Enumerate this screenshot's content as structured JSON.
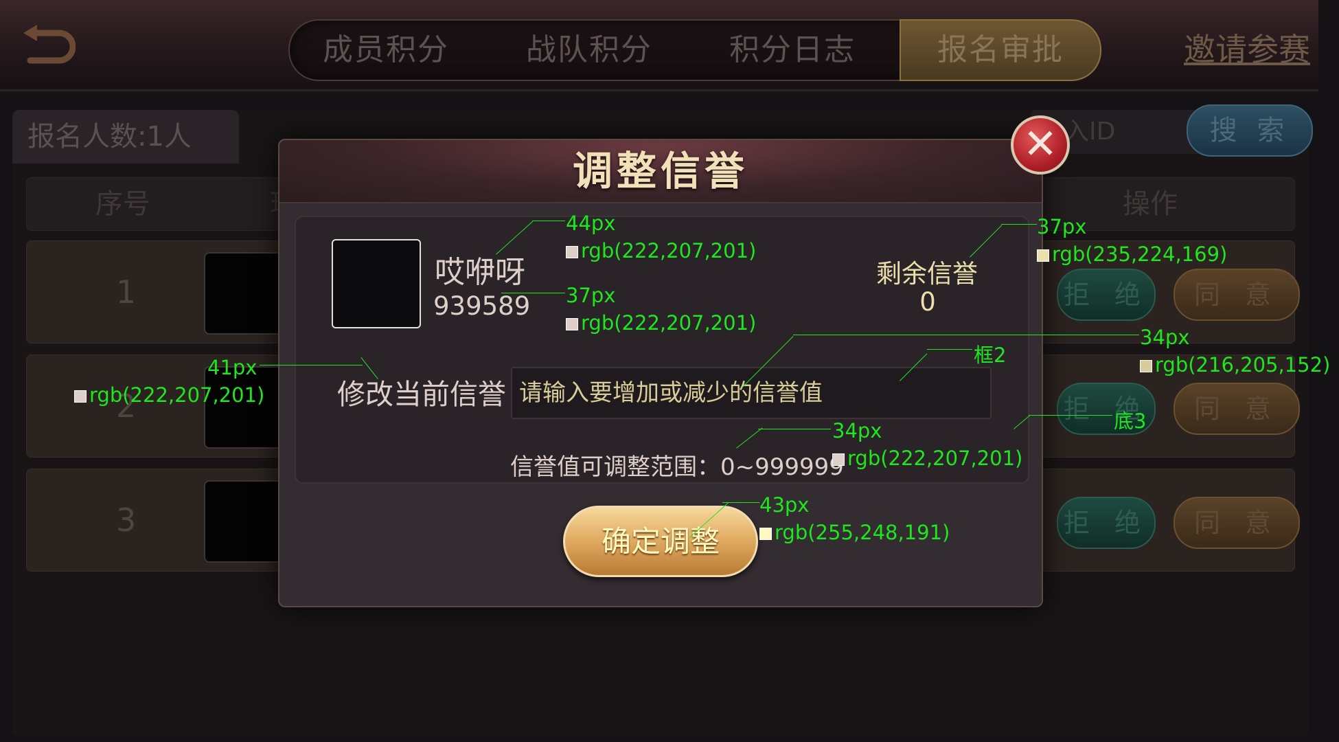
{
  "header": {
    "tabs": [
      {
        "label": "成员积分",
        "active": false
      },
      {
        "label": "战队积分",
        "active": false
      },
      {
        "label": "积分日志",
        "active": false
      },
      {
        "label": "报名审批",
        "active": true
      }
    ],
    "invite_link": "邀请参赛",
    "back_icon": "back-arrow-icon"
  },
  "list": {
    "count_label": "报名人数:1人",
    "search_placeholder": "入ID",
    "search_button": "搜 索",
    "columns": {
      "index": "序号",
      "partial": "玩",
      "action": "操作"
    },
    "rows": [
      {
        "index": "1",
        "reject": "拒 绝",
        "agree": "同 意"
      },
      {
        "index": "2",
        "reject": "拒 绝",
        "agree": "同 意"
      },
      {
        "index": "3",
        "reject": "拒 绝",
        "agree": "同 意"
      }
    ]
  },
  "modal": {
    "title": "调整信誉",
    "close_icon": "close-x-icon",
    "user_name": "哎咿呀",
    "user_id": "939589",
    "remaining_label": "剩余信誉",
    "remaining_value": "0",
    "modify_label": "修改当前信誉",
    "input_placeholder": "请输入要增加或减少的信誉值",
    "range_text": "信誉值可调整范围：0~999999",
    "confirm_button": "确定调整"
  },
  "annotations": {
    "name_size": "44px",
    "name_color": "rgb(222,207,201)",
    "id_size": "37px",
    "id_color": "rgb(222,207,201)",
    "remain_size": "37px",
    "remain_color": "rgb(235,224,169)",
    "input_size": "34px",
    "input_color": "rgb(216,205,152)",
    "frame_tag": "框2",
    "bottom_tag": "底3",
    "modify_size": "41px",
    "modify_color": "rgb(222,207,201)",
    "range_size": "34px",
    "range_color": "rgb(222,207,201)",
    "confirm_size": "43px",
    "confirm_color": "rgb(255,248,191)"
  },
  "colors": {
    "name_text": "#decfc9",
    "remain_text": "#ebe0a9",
    "input_text": "#d8cd98",
    "confirm_text": "#fff8bf",
    "annotation": "#1fe61f"
  }
}
